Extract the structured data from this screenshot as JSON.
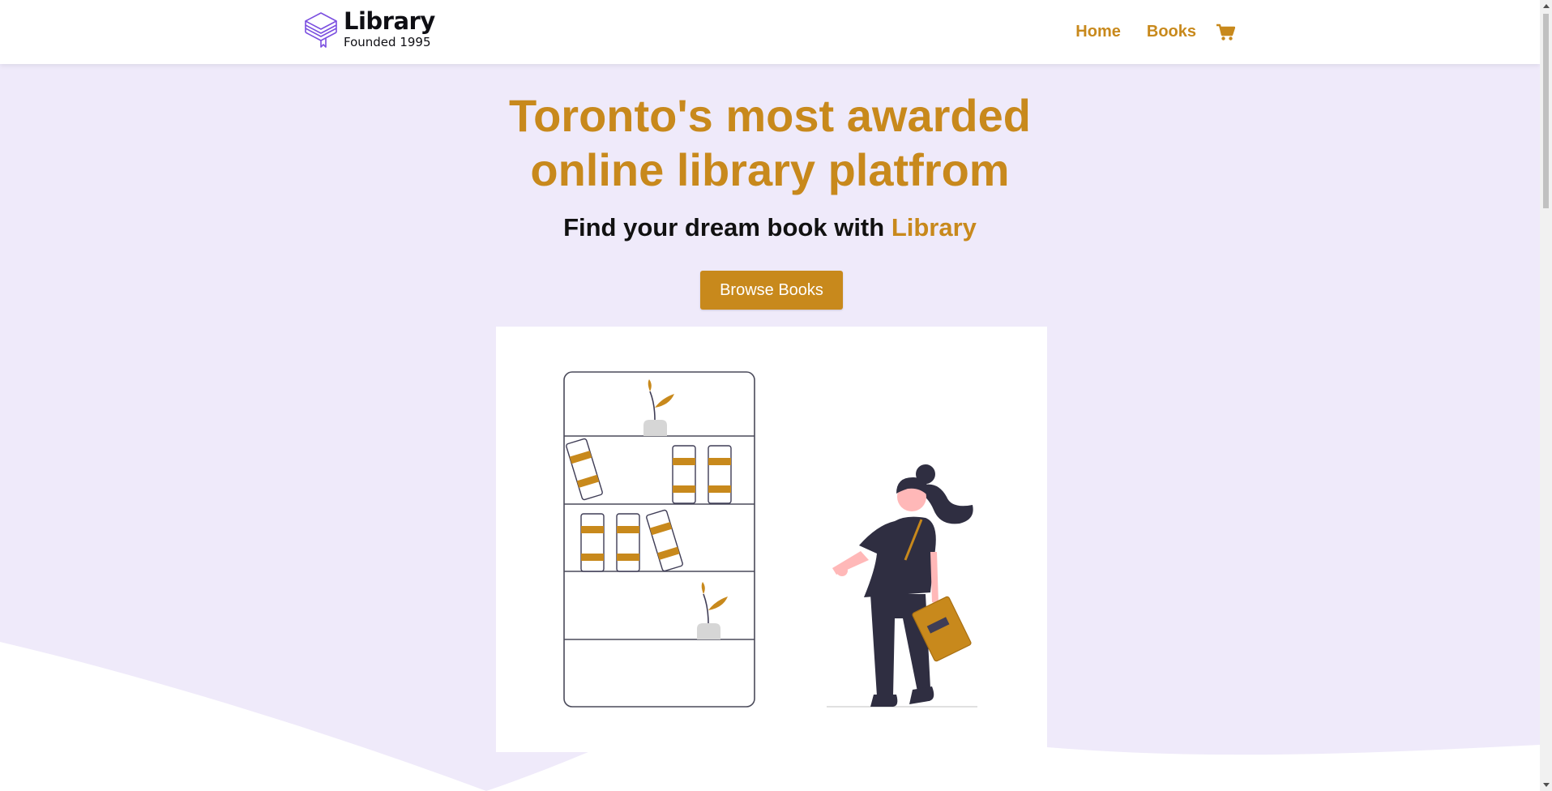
{
  "brand": {
    "name": "Library",
    "tagline": "Founded 1995"
  },
  "nav": {
    "links": [
      {
        "label": "Home"
      },
      {
        "label": "Books"
      }
    ],
    "cart_icon": "shopping-cart-icon"
  },
  "hero": {
    "title_line1": "Toronto's most awarded",
    "title_line2": "online library platfrom",
    "subtitle_prefix": "Find your dream book with ",
    "subtitle_accent": "Library",
    "cta_label": "Browse Books"
  },
  "colors": {
    "accent": "#c8891c",
    "hero_background": "#efeafa",
    "logo_purple": "#7b4fe0",
    "text_dark": "#111111"
  }
}
